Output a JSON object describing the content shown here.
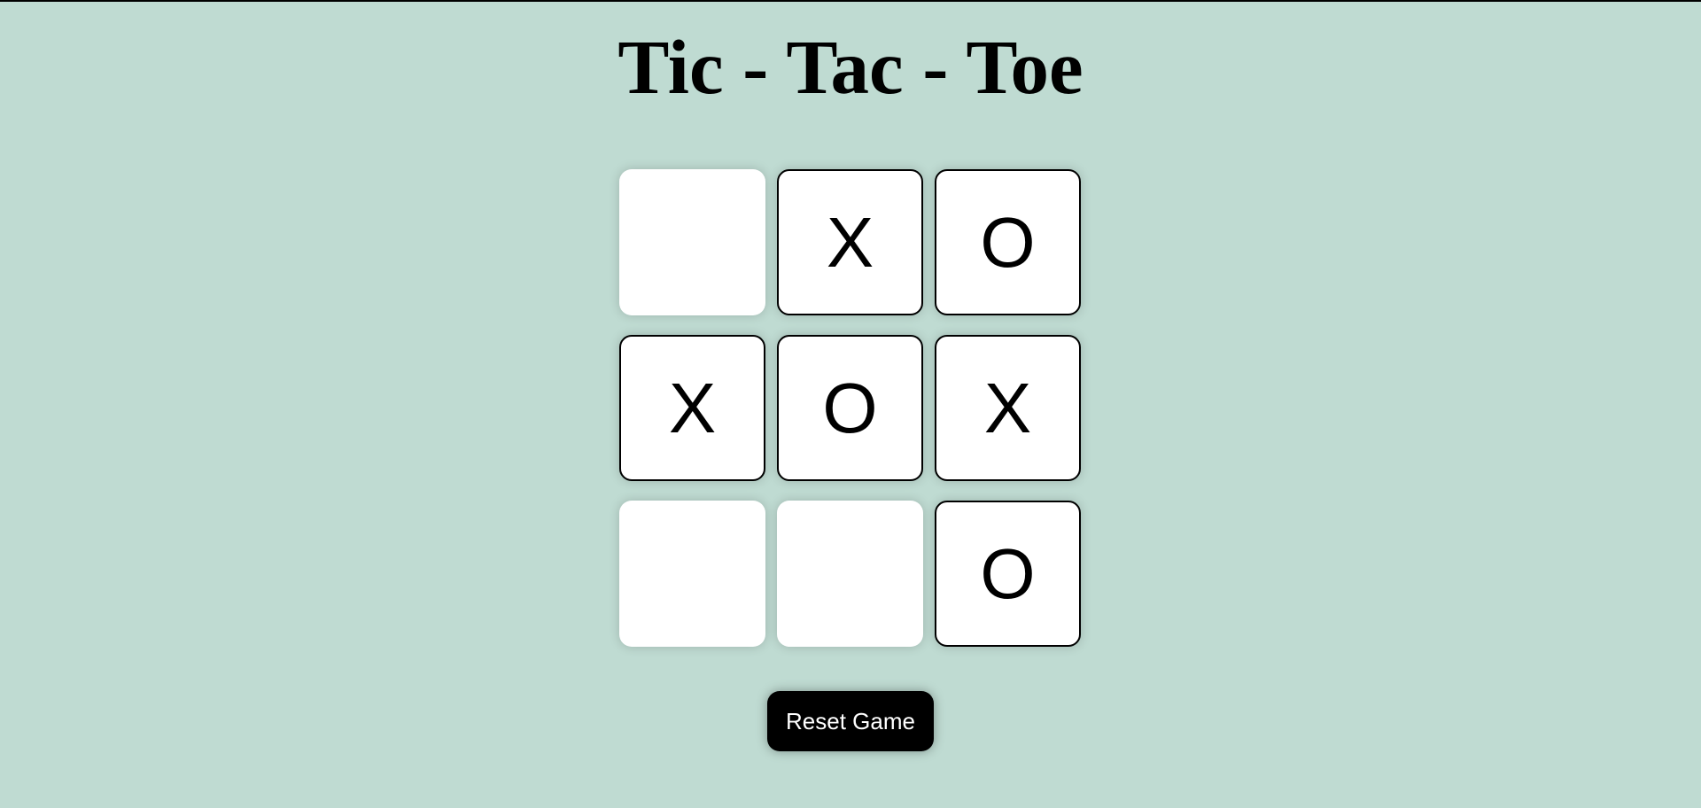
{
  "title": "Tic - Tac - Toe",
  "board": {
    "cells": [
      "",
      "X",
      "O",
      "X",
      "O",
      "X",
      "",
      "",
      "O"
    ]
  },
  "reset_button": {
    "label": "Reset Game"
  },
  "colors": {
    "background": "#bfdbd2",
    "cell": "#ffffff",
    "button": "#000000",
    "button_text": "#ffffff"
  }
}
